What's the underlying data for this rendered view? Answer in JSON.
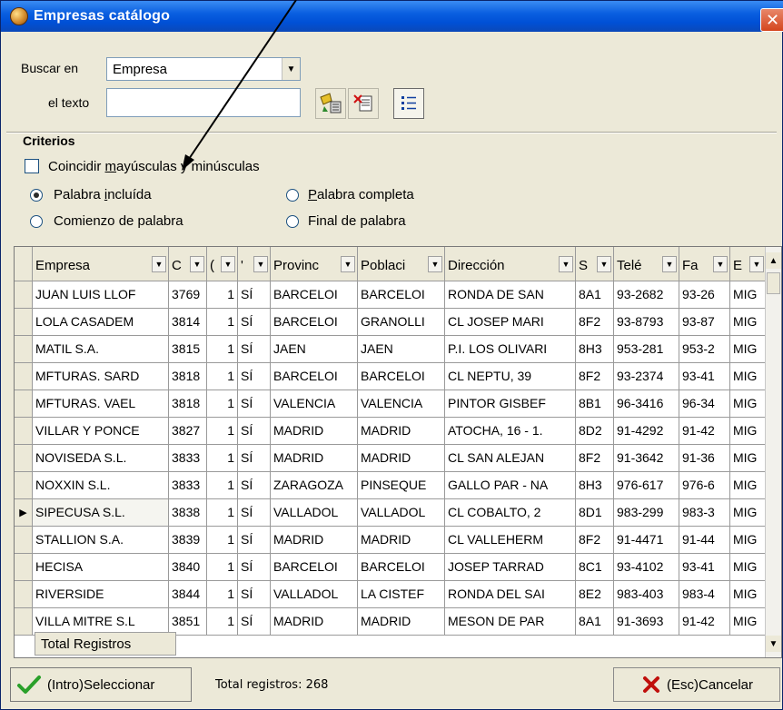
{
  "window": {
    "title": "Empresas catálogo",
    "close_glyph": "✕"
  },
  "search": {
    "search_in_label": "Buscar en",
    "search_in_value": "Empresa",
    "text_label": "el texto",
    "text_value": "",
    "text_placeholder": ""
  },
  "criteria": {
    "title": "Criterios",
    "match_case_prefix": "Coincidir ",
    "match_case_accel": "m",
    "match_case_suffix": "ayúsculas y minúsculas",
    "match_case_checked": false,
    "options": [
      {
        "prefix": "Palabra ",
        "accel": "i",
        "suffix": "ncluída",
        "checked": true
      },
      {
        "prefix": "",
        "accel": "P",
        "suffix": "alabra completa",
        "checked": false
      },
      {
        "prefix": "Comienzo de palabra",
        "accel": "",
        "suffix": "",
        "checked": false
      },
      {
        "prefix": "Final de palabra",
        "accel": "",
        "suffix": "",
        "checked": false
      }
    ]
  },
  "grid": {
    "columns": [
      "Empresa",
      "C",
      "(",
      "'",
      "Provinc",
      "Poblaci",
      "Dirección",
      "S",
      "Telé",
      "Fa",
      "E"
    ],
    "rows": [
      [
        "JUAN LUIS LLOF",
        "3769",
        "1",
        "SÍ",
        "BARCELOI",
        "BARCELOI",
        "RONDA DE SAN",
        "8A1",
        "93-2682",
        "93-26",
        "MIG"
      ],
      [
        "LOLA CASADEM",
        "3814",
        "1",
        "SÍ",
        "BARCELOI",
        "GRANOLLI",
        "CL JOSEP MARI",
        "8F2",
        "93-8793",
        "93-87",
        "MIG"
      ],
      [
        "MATIL S.A.",
        "3815",
        "1",
        "SÍ",
        "JAEN",
        "JAEN",
        "P.I. LOS OLIVARI",
        "8H3",
        "953-281",
        "953-2",
        "MIG"
      ],
      [
        "MFTURAS. SARD",
        "3818",
        "1",
        "SÍ",
        "BARCELOI",
        "BARCELOI",
        "CL NEPTU, 39",
        "8F2",
        "93-2374",
        "93-41",
        "MIG"
      ],
      [
        "MFTURAS. VAEL",
        "3818",
        "1",
        "SÍ",
        "VALENCIA",
        "VALENCIA",
        "PINTOR GISBEF",
        "8B1",
        "96-3416",
        "96-34",
        "MIG"
      ],
      [
        "VILLAR Y PONCE",
        "3827",
        "1",
        "SÍ",
        "MADRID",
        "MADRID",
        "ATOCHA, 16 - 1.",
        "8D2",
        "91-4292",
        "91-42",
        "MIG"
      ],
      [
        "NOVISEDA S.L.",
        "3833",
        "1",
        "SÍ",
        "MADRID",
        "MADRID",
        "CL SAN ALEJAN",
        "8F2",
        "91-3642",
        "91-36",
        "MIG"
      ],
      [
        "NOXXIN S.L.",
        "3833",
        "1",
        "SÍ",
        "ZARAGOZA",
        "PINSEQUE",
        "GALLO PAR - NA",
        "8H3",
        "976-617",
        "976-6",
        "MIG"
      ],
      [
        "SIPECUSA S.L.",
        "3838",
        "1",
        "SÍ",
        "VALLADOL",
        "VALLADOL",
        "CL COBALTO, 2",
        "8D1",
        "983-299",
        "983-3",
        "MIG"
      ],
      [
        "STALLION S.A.",
        "3839",
        "1",
        "SÍ",
        "MADRID",
        "MADRID",
        "CL VALLEHERM",
        "8F2",
        "91-4471",
        "91-44",
        "MIG"
      ],
      [
        "HECISA",
        "3840",
        "1",
        "SÍ",
        "BARCELOI",
        "BARCELOI",
        "JOSEP TARRAD",
        "8C1",
        "93-4102",
        "93-41",
        "MIG"
      ],
      [
        "RIVERSIDE",
        "3844",
        "1",
        "SÍ",
        "VALLADOL",
        "LA CISTEF",
        "RONDA DEL SAI",
        "8E2",
        "983-403",
        "983-4",
        "MIG"
      ],
      [
        "VILLA MITRE S.L",
        "3851",
        "1",
        "SÍ",
        "MADRID",
        "MADRID",
        "MESON DE PAR",
        "8A1",
        "91-3693",
        "91-42",
        "MIG"
      ]
    ],
    "selected_row_index": 8,
    "footer_label": "Total Registros"
  },
  "footer": {
    "select_label": "(Intro)Seleccionar",
    "status": "Total registros:  268",
    "cancel_label": "(Esc)Cancelar"
  },
  "colors": {
    "title_bar": "#0a5fe0",
    "window_bg": "#ece9d8",
    "select_check": "#2aa02a",
    "cancel_x": "#c0100c"
  }
}
